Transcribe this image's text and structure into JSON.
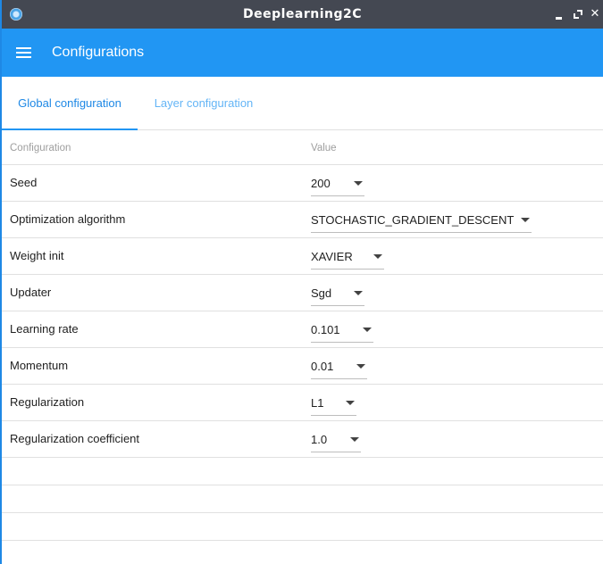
{
  "window": {
    "title": "Deeplearning2C"
  },
  "appbar": {
    "title": "Configurations"
  },
  "tabs": [
    {
      "label": "Global configuration",
      "active": true
    },
    {
      "label": "Layer configuration",
      "active": false
    }
  ],
  "table": {
    "headers": {
      "config": "Configuration",
      "value": "Value"
    },
    "rows": [
      {
        "label": "Seed",
        "value": "200"
      },
      {
        "label": "Optimization algorithm",
        "value": "STOCHASTIC_GRADIENT_DESCENT"
      },
      {
        "label": "Weight init",
        "value": "XAVIER"
      },
      {
        "label": "Updater",
        "value": "Sgd"
      },
      {
        "label": "Learning rate",
        "value": "0.101"
      },
      {
        "label": "Momentum",
        "value": "0.01"
      },
      {
        "label": "Regularization",
        "value": "L1"
      },
      {
        "label": "Regularization coefficient",
        "value": "1.0"
      }
    ]
  },
  "colors": {
    "accent": "#2196f3",
    "titlebar": "#444852"
  }
}
